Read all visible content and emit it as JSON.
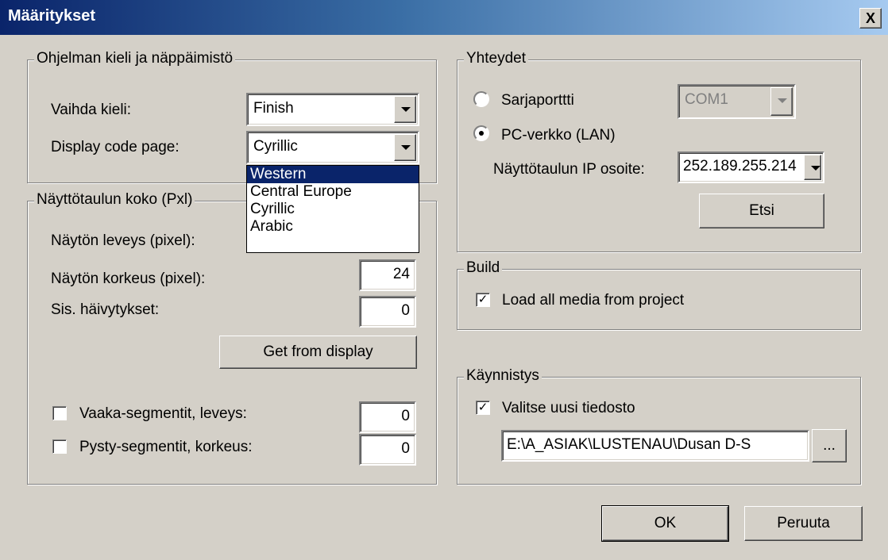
{
  "window": {
    "title": "Määritykset",
    "close_label": "X"
  },
  "language_group": {
    "legend": "Ohjelman kieli ja näppäimistö",
    "change_language_label": "Vaihda kieli:",
    "change_language_value": "Finish",
    "code_page_label": "Display code page:",
    "code_page_value": "Cyrillic",
    "code_page_options": [
      "Western",
      "Central Europe",
      "Cyrillic",
      "Arabic"
    ],
    "code_page_highlighted": "Western"
  },
  "display_group": {
    "legend": "Näyttötaulun koko (Pxl)",
    "width_label": "Näytön leveys (pixel):",
    "height_label": "Näytön korkeus (pixel):",
    "height_value": "24",
    "fades_label": "Sis. häivytykset:",
    "fades_value": "0",
    "get_from_display_label": "Get from display",
    "horizontal_segments_label": "Vaaka-segmentit, leveys:",
    "horizontal_segments_checked": false,
    "horizontal_segments_value": "0",
    "vertical_segments_label": "Pysty-segmentit, korkeus:",
    "vertical_segments_checked": false,
    "vertical_segments_value": "0"
  },
  "connections_group": {
    "legend": "Yhteydet",
    "serial_label": "Sarjaporttti",
    "serial_selected": false,
    "com_port_value": "COM1",
    "lan_label": "PC-verkko (LAN)",
    "lan_selected": true,
    "ip_label": "Näyttötaulun IP osoite:",
    "ip_value": "252.189.255.214",
    "search_label": "Etsi"
  },
  "build_group": {
    "legend": "Build",
    "load_media_label": "Load all media from project",
    "load_media_checked": true
  },
  "startup_group": {
    "legend": "Käynnistys",
    "new_file_label": "Valitse uusi tiedosto",
    "new_file_checked": true,
    "file_path_value": "E:\\A_ASIAK\\LUSTENAU\\Dusan D-S",
    "browse_label": "..."
  },
  "buttons": {
    "ok_label": "OK",
    "cancel_label": "Peruuta"
  },
  "colors": {
    "titlebar_start": "#0a246a",
    "titlebar_end": "#a6caf0",
    "face": "#d4d0c8",
    "selection": "#0a246a"
  }
}
